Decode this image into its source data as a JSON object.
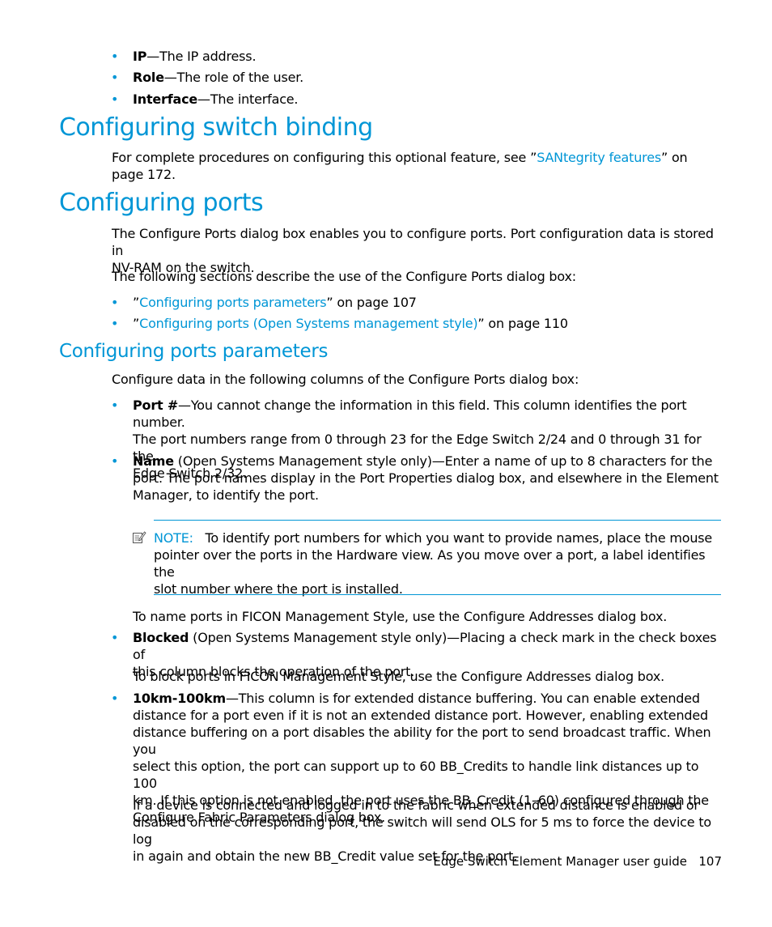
{
  "top_bullets": [
    {
      "term": "IP",
      "desc": "—The IP address."
    },
    {
      "term": "Role",
      "desc": "—The role of the user."
    },
    {
      "term": "Interface",
      "desc": "—The interface."
    }
  ],
  "section_switch_binding": {
    "heading": "Configuring switch binding",
    "text_before": "For complete procedures on configuring this optional feature, see ”",
    "link": "SANtegrity features",
    "text_after": "” on",
    "text_line2": "page 172."
  },
  "section_ports": {
    "heading": "Configuring ports",
    "para1_line1": "The Configure Ports dialog box enables you to configure ports. Port configuration data is stored in",
    "para1_line2": "NV-RAM on the switch.",
    "para2": "The following sections describe the use of the Configure Ports dialog box:",
    "links": [
      {
        "prefix": "”",
        "link": "Configuring ports parameters",
        "suffix": "” on page 107"
      },
      {
        "prefix": "”",
        "link": "Configuring ports (Open Systems management style)",
        "suffix": "” on page 110"
      }
    ]
  },
  "section_params": {
    "heading": "Configuring ports parameters",
    "intro": "Configure data in the following columns of the Configure Ports dialog box:",
    "port": {
      "term": "Port #",
      "line1": "—You cannot change the information in this field. This column identifies the port number.",
      "line2": "The port numbers range from 0 through 23 for the Edge Switch 2/24 and 0 through 31 for the",
      "line3": "Edge Switch 2/32."
    },
    "name": {
      "term": "Name",
      "line1": " (Open Systems Management style only)—Enter a name of up to 8 characters for the",
      "line2": "port. The port names display in the Port Properties dialog box, and elsewhere in the Element",
      "line3": "Manager, to identify the port."
    },
    "note": {
      "label": "NOTE:",
      "line1": "To identify port numbers for which you want to provide names, place the mouse",
      "line2": "pointer over the ports in the Hardware view. As you move over a port, a label identifies the",
      "line3": "slot number where the port is installed."
    },
    "name_ficon": "To name ports in FICON Management Style, use the Configure Addresses dialog box.",
    "blocked": {
      "term": "Blocked",
      "line1": " (Open Systems Management style only)—Placing a check mark in the check boxes of",
      "line2": "this column blocks the operation of the port.",
      "ficon": "To block ports in FICON Management Style, use the Configure Addresses dialog box."
    },
    "km": {
      "term": "10km-100km",
      "line1": "—This column is for extended distance buffering. You can enable extended",
      "line2": "distance for a port even if it is not an extended distance port. However, enabling extended",
      "line3": "distance buffering on a port disables the ability for the port to send broadcast traffic. When you",
      "line4": "select this option, the port can support up to 60 BB_Credits to handle link distances up to 100",
      "line5": "km. If this option is not enabled, the port uses the BB_Credit (1–60) configured through the",
      "line6": "Configure Fabric Parameters dialog box.",
      "para_line1": "If a device is connected and logged in to the fabric when extended distance is enabled or",
      "para_line2": "disabled on the corresponding port, the switch will send OLS for 5 ms to force the device to log",
      "para_line3": "in again and obtain the new BB_Credit value set for the port."
    }
  },
  "footer": {
    "title": "Edge Switch Element Manager user guide",
    "page": "107"
  }
}
